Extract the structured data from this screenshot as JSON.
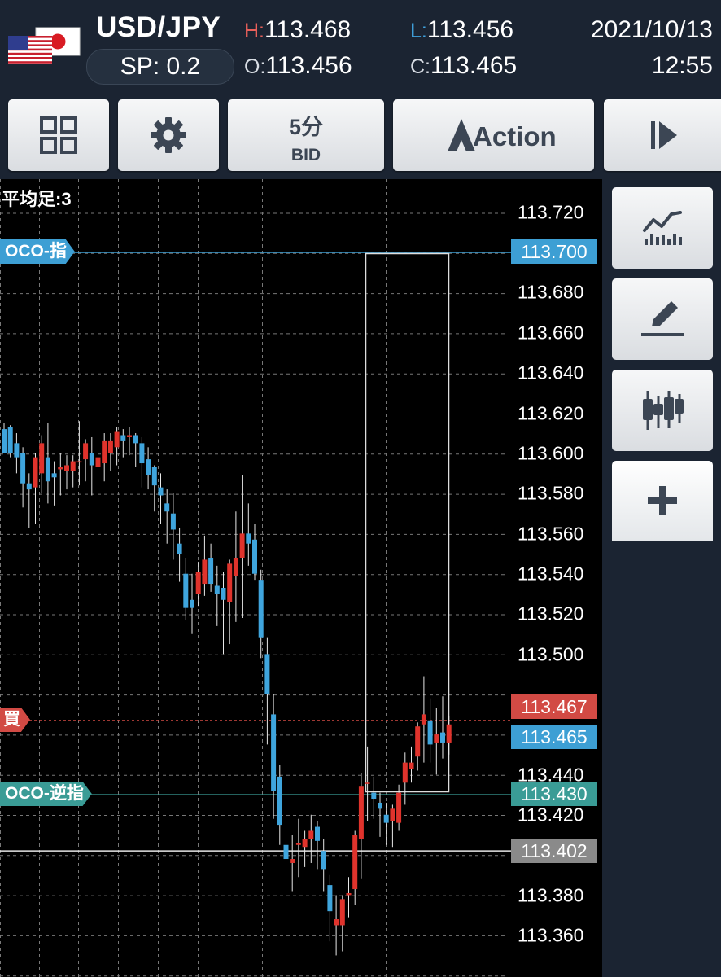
{
  "header": {
    "pair": "USD/JPY",
    "spread": "SP: 0.2",
    "high": {
      "label": "H:",
      "value": "113.468"
    },
    "low": {
      "label": "L:",
      "value": "113.456"
    },
    "open": {
      "label": "O:",
      "value": "113.456"
    },
    "close": {
      "label": "C:",
      "value": "113.465"
    },
    "date": "2021/10/13",
    "time": "12:55",
    "flags": [
      "us-flag",
      "jp-flag"
    ]
  },
  "toolbar": {
    "grid_icon": "grid-icon",
    "settings_icon": "gear-icon",
    "timeframe_label": "5分",
    "price_type_label": "BID",
    "action_label": "Action",
    "play_icon": "play-icon"
  },
  "chart": {
    "indicator_label": "平均足:3",
    "price_ticks": [
      "113.720",
      "113.680",
      "113.660",
      "113.640",
      "113.620",
      "113.600",
      "113.580",
      "113.560",
      "113.540",
      "113.520",
      "113.500",
      "113.440",
      "113.420",
      "113.380",
      "113.360"
    ],
    "lines": [
      {
        "id": "oco-limit",
        "label": "OCO-指",
        "price": "113.700",
        "color": "#3d9fd4"
      },
      {
        "id": "ask",
        "label": "買",
        "price": "113.467",
        "color": "#d24a44"
      },
      {
        "id": "bid",
        "label": "",
        "price": "113.465",
        "color": "#3d9fd4"
      },
      {
        "id": "oco-stop",
        "label": "OCO-逆指",
        "price": "113.430",
        "color": "#3a9c96"
      },
      {
        "id": "ref",
        "label": "",
        "price": "113.402",
        "color": "#8a8a8a"
      }
    ],
    "colors": {
      "up": "#e0332c",
      "down": "#3fa5dd",
      "grid": "#777777",
      "background": "#000000"
    }
  },
  "side": {
    "buttons": [
      "indicator-chart-icon",
      "pencil-draw-icon",
      "candles-icon",
      "plus-icon"
    ]
  },
  "chart_data": {
    "type": "candlestick",
    "title": "",
    "xlabel": "",
    "ylabel": "",
    "ylim": [
      113.34,
      113.738
    ],
    "candles": [
      [
        113.612,
        113.615,
        113.601,
        113.6
      ],
      [
        113.613,
        113.614,
        113.598,
        113.6
      ],
      [
        113.605,
        113.61,
        113.59,
        113.598
      ],
      [
        113.6,
        113.603,
        113.573,
        113.585
      ],
      [
        113.585,
        113.59,
        113.563,
        113.582
      ],
      [
        113.583,
        113.6,
        113.565,
        113.598
      ],
      [
        113.59,
        113.609,
        113.58,
        113.605
      ],
      [
        113.598,
        113.615,
        113.575,
        113.586
      ],
      [
        113.59,
        113.596,
        113.574,
        113.588
      ],
      [
        113.592,
        113.6,
        113.579,
        113.593
      ],
      [
        113.591,
        113.599,
        113.582,
        113.594
      ],
      [
        113.591,
        113.599,
        113.583,
        113.596
      ],
      [
        113.596,
        113.616,
        113.584,
        113.596
      ],
      [
        113.597,
        113.607,
        113.586,
        113.605
      ],
      [
        113.6,
        113.608,
        113.579,
        113.594
      ],
      [
        113.593,
        113.609,
        113.575,
        113.598
      ],
      [
        113.595,
        113.61,
        113.586,
        113.606
      ],
      [
        113.6,
        113.61,
        113.591,
        113.606
      ],
      [
        113.603,
        113.613,
        113.594,
        113.611
      ],
      [
        113.609,
        113.612,
        113.598,
        113.606
      ],
      [
        113.608,
        113.613,
        113.599,
        113.609
      ],
      [
        113.609,
        113.61,
        113.593,
        113.605
      ],
      [
        113.605,
        113.608,
        113.583,
        113.595
      ],
      [
        113.597,
        113.603,
        113.582,
        113.589
      ],
      [
        113.593,
        113.594,
        113.571,
        113.584
      ],
      [
        113.583,
        113.59,
        113.565,
        113.579
      ],
      [
        113.575,
        113.582,
        113.555,
        113.571
      ],
      [
        113.57,
        113.58,
        113.547,
        113.562
      ],
      [
        113.555,
        113.563,
        113.536,
        113.55
      ],
      [
        113.54,
        113.548,
        113.517,
        113.523
      ],
      [
        113.527,
        113.54,
        113.51,
        113.523
      ],
      [
        113.53,
        113.546,
        113.524,
        113.541
      ],
      [
        113.535,
        113.559,
        113.529,
        113.547
      ],
      [
        113.548,
        113.555,
        113.531,
        113.535
      ],
      [
        113.534,
        113.544,
        113.514,
        113.53
      ],
      [
        113.533,
        113.541,
        113.5,
        113.527
      ],
      [
        113.526,
        113.547,
        113.505,
        113.545
      ],
      [
        113.539,
        113.571,
        113.516,
        113.548
      ],
      [
        113.548,
        113.589,
        113.518,
        113.56
      ],
      [
        113.56,
        113.575,
        113.544,
        113.555
      ],
      [
        113.557,
        113.565,
        113.537,
        113.54
      ],
      [
        113.537,
        113.542,
        113.498,
        113.508
      ],
      [
        113.5,
        113.508,
        113.455,
        113.48
      ],
      [
        113.47,
        113.48,
        113.418,
        113.432
      ],
      [
        113.439,
        113.445,
        113.405,
        113.415
      ],
      [
        113.405,
        113.413,
        113.386,
        113.398
      ],
      [
        113.396,
        113.41,
        113.382,
        113.398
      ],
      [
        113.405,
        113.418,
        113.389,
        113.406
      ],
      [
        113.404,
        113.412,
        113.394,
        113.408
      ],
      [
        113.408,
        113.42,
        113.396,
        113.412
      ],
      [
        113.414,
        113.417,
        113.393,
        113.407
      ],
      [
        113.402,
        113.408,
        113.382,
        113.393
      ],
      [
        113.385,
        113.39,
        113.357,
        113.372
      ],
      [
        113.365,
        113.38,
        113.35,
        113.368
      ],
      [
        113.365,
        113.38,
        113.352,
        113.378
      ],
      [
        113.38,
        113.389,
        113.369,
        113.381
      ],
      [
        113.383,
        113.412,
        113.375,
        113.41
      ],
      [
        113.408,
        113.441,
        113.388,
        113.434
      ],
      [
        113.436,
        113.454,
        113.417,
        113.436
      ],
      [
        113.431,
        113.439,
        113.418,
        113.428
      ],
      [
        113.426,
        113.431,
        113.409,
        113.423
      ],
      [
        113.42,
        113.426,
        113.405,
        113.416
      ],
      [
        113.417,
        113.425,
        113.404,
        113.423
      ],
      [
        113.416,
        113.435,
        113.412,
        113.431
      ],
      [
        113.436,
        113.451,
        113.425,
        113.446
      ],
      [
        113.443,
        113.454,
        113.436,
        113.446
      ],
      [
        113.449,
        113.466,
        113.442,
        113.464
      ],
      [
        113.465,
        113.489,
        113.446,
        113.47
      ],
      [
        113.467,
        113.478,
        113.446,
        113.455
      ],
      [
        113.456,
        113.473,
        113.44,
        113.46
      ],
      [
        113.461,
        113.479,
        113.448,
        113.456
      ],
      [
        113.456,
        113.469,
        113.45,
        113.465
      ]
    ]
  }
}
